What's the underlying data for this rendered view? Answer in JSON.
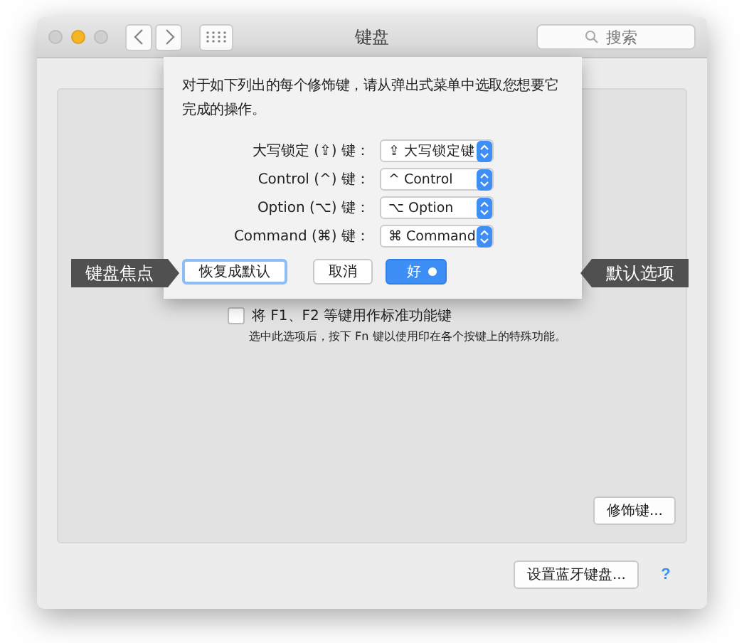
{
  "window": {
    "title": "键盘",
    "search": {
      "placeholder": "搜索"
    }
  },
  "sheet": {
    "instruction": "对于如下列出的每个修饰键，请从弹出式菜单中选取您想要它完成的操作。",
    "modifiers": [
      {
        "label": "大写锁定 (⇪) 键：",
        "value": "⇪ 大写锁定键"
      },
      {
        "label": "Control (^) 键：",
        "value": "^ Control"
      },
      {
        "label": "Option (⌥) 键：",
        "value": "⌥ Option"
      },
      {
        "label": "Command (⌘) 键：",
        "value": "⌘ Command"
      }
    ],
    "buttons": [
      {
        "label": "恢复成默认",
        "kind": "focus"
      },
      {
        "label": "取消",
        "kind": "normal"
      },
      {
        "label": "好",
        "kind": "default"
      }
    ]
  },
  "callouts": [
    {
      "text": "键盘焦点"
    },
    {
      "text": "默认选项"
    }
  ],
  "fn_option": {
    "label": "将 F1、F2 等键用作标准功能键",
    "checked": false,
    "hint": "选中此选项后，按下 Fn 键以使用印在各个按键上的特殊功能。"
  },
  "modifier_keys_button": "修饰键...",
  "bluetooth_button": "设置蓝牙键盘...",
  "help": "?"
}
